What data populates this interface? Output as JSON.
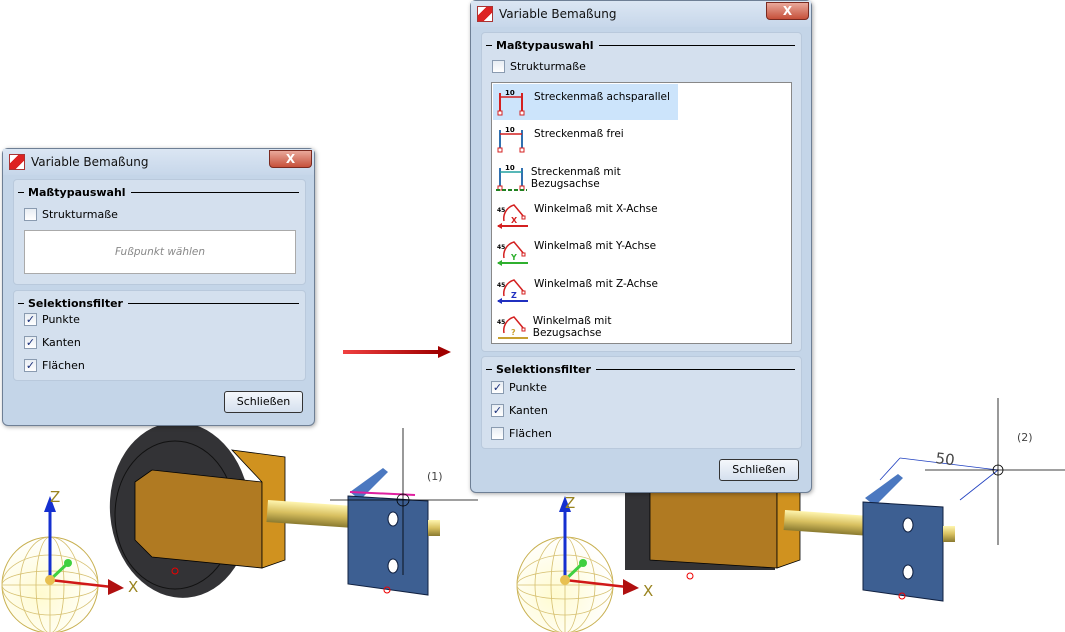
{
  "left_dialog": {
    "title": "Variable Bemaßung",
    "close_label": "X",
    "group1_title": "Maßtypauswahl",
    "structure_label": "Strukturmaße",
    "structure_checked": false,
    "hint": "Fußpunkt wählen",
    "group2_title": "Selektionsfilter",
    "filters": [
      {
        "label": "Punkte",
        "checked": true
      },
      {
        "label": "Kanten",
        "checked": true
      },
      {
        "label": "Flächen",
        "checked": true
      }
    ],
    "close_button": "Schließen"
  },
  "right_dialog": {
    "title": "Variable Bemaßung",
    "close_label": "X",
    "group1_title": "Maßtypauswahl",
    "structure_label": "Strukturmaße",
    "structure_checked": false,
    "types": [
      {
        "label": "Streckenmaß achsparallel",
        "icon": "linear-dimension-axis-parallel-icon",
        "selected": true
      },
      {
        "label": "Streckenmaß frei",
        "icon": "linear-dimension-free-icon"
      },
      {
        "label": "Streckenmaß mit Bezugsachse",
        "icon": "linear-dimension-reference-axis-icon"
      },
      {
        "label": "Winkelmaß mit X-Achse",
        "icon": "angle-x-axis-icon",
        "color": "#d42020",
        "axis": "X"
      },
      {
        "label": "Winkelmaß mit Y-Achse",
        "icon": "angle-y-axis-icon",
        "color": "#2fb02f",
        "axis": "Y"
      },
      {
        "label": "Winkelmaß mit Z-Achse",
        "icon": "angle-z-axis-icon",
        "color": "#2030c0",
        "axis": "Z"
      },
      {
        "label": "Winkelmaß mit Bezugsachse",
        "icon": "angle-reference-axis-icon",
        "color": "#c8a030",
        "axis": "?"
      }
    ],
    "group2_title": "Selektionsfilter",
    "filters": [
      {
        "label": "Punkte",
        "checked": true
      },
      {
        "label": "Kanten",
        "checked": true
      },
      {
        "label": "Flächen",
        "checked": false
      }
    ],
    "close_button": "Schließen"
  },
  "scene": {
    "axis_x": "X",
    "axis_z": "Z",
    "marker1": "(1)",
    "marker2": "(2)",
    "dimension_value": "50",
    "arrow_color": "#d01818"
  }
}
